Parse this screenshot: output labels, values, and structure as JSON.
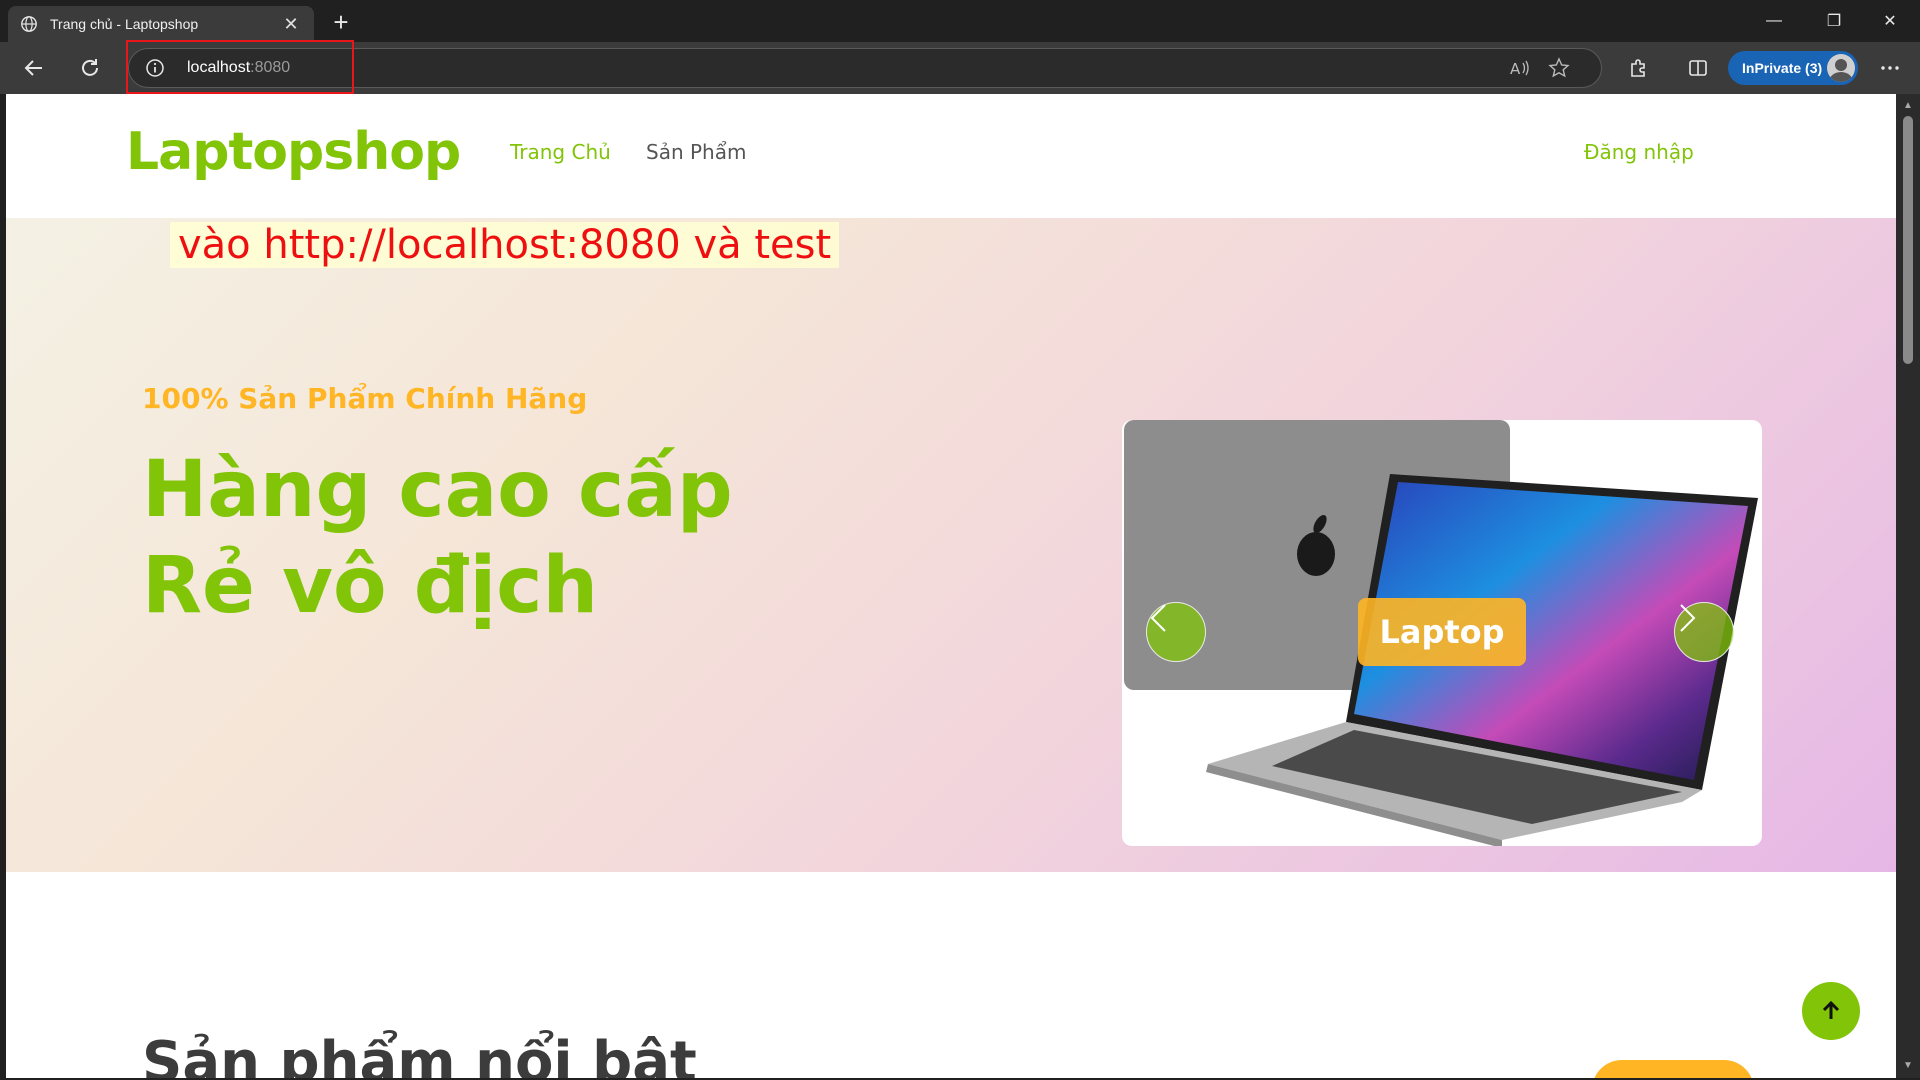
{
  "browser": {
    "tab_title": "Trang chủ - Laptopshop",
    "address_host": "localhost",
    "address_port": ":8080",
    "inprivate_label": "InPrivate (3)"
  },
  "icons": {
    "tab": "globe-icon",
    "close": "close-icon",
    "newtab": "plus-icon",
    "back": "back-arrow-icon",
    "reload": "reload-icon",
    "info": "info-icon",
    "read_aloud": "read-aloud-icon",
    "favorite": "star-icon",
    "extensions": "puzzle-icon",
    "split": "split-screen-icon",
    "more": "more-icon",
    "scroll_top": "arrow-up-icon"
  },
  "site": {
    "brand": "Laptopshop",
    "nav": {
      "home": "Trang Chủ",
      "products": "Sản Phẩm",
      "login": "Đăng nhập"
    },
    "annotation": "vào http://localhost:8080 và test",
    "hero": {
      "subtitle": "100% Sản Phẩm Chính Hãng",
      "title_line1": "Hàng cao cấp",
      "title_line2": "Rẻ vô địch",
      "carousel_label": "Laptop"
    },
    "section_title": "Sản phẩm nổi bật"
  },
  "colors": {
    "primary_green": "#81c408",
    "accent_orange": "#ffb524",
    "annotation_red": "#ee1010",
    "highlight_box": "#e8151b"
  }
}
